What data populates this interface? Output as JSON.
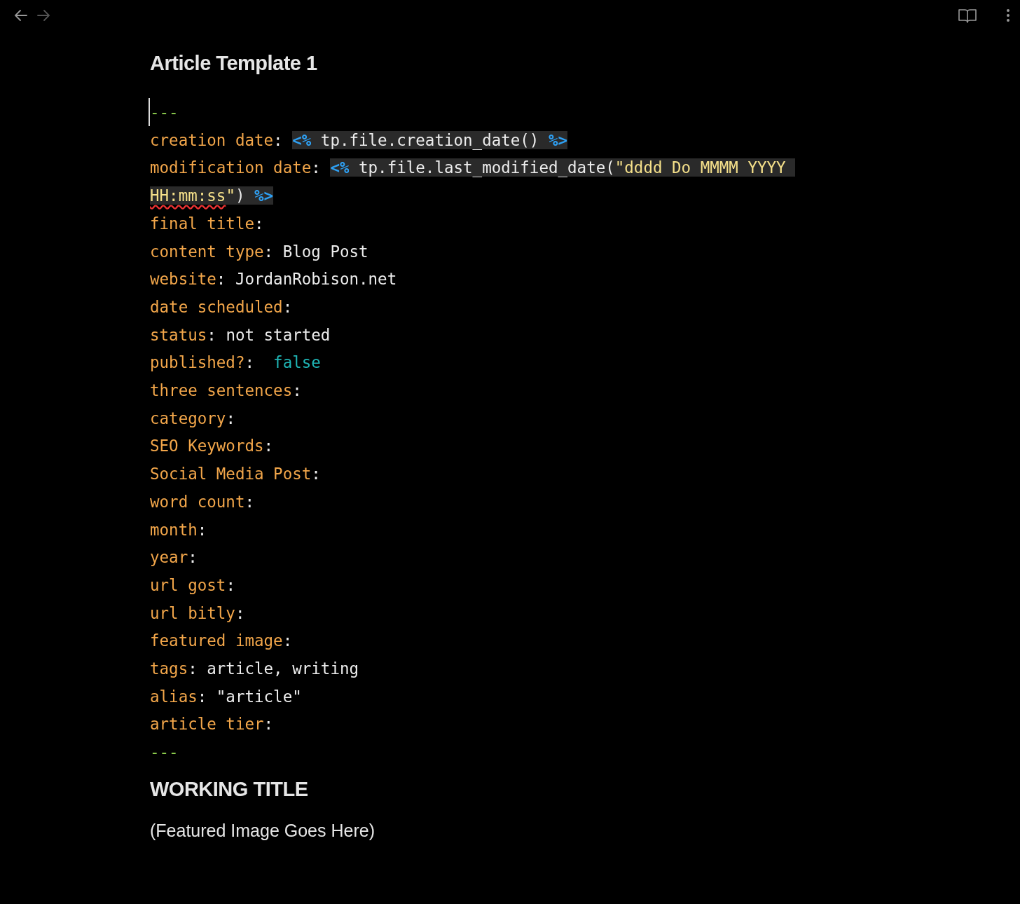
{
  "toolbar": {
    "back_disabled": false,
    "forward_disabled": true
  },
  "note": {
    "title": "Article Template 1",
    "frontmatter": [
      [
        {
          "kind": "dash",
          "text": "---"
        }
      ],
      [
        {
          "kind": "key",
          "text": "creation date"
        },
        {
          "kind": "punct",
          "text": ": "
        },
        {
          "kind": "delim",
          "text": "<%"
        },
        {
          "kind": "code",
          "text": " tp.file.creation_date() "
        },
        {
          "kind": "delim",
          "text": "%>"
        }
      ],
      [
        {
          "kind": "key",
          "text": "modification date"
        },
        {
          "kind": "punct",
          "text": ": "
        },
        {
          "kind": "delim",
          "text": "<%"
        },
        {
          "kind": "code",
          "text": " tp.file.last_modified_date("
        },
        {
          "kind": "string",
          "text": "\"dddd Do MMMM YYYY "
        },
        {
          "kind": "string",
          "text": "HH:mm:ss",
          "misspelled": true
        },
        {
          "kind": "string",
          "text": "\""
        },
        {
          "kind": "code",
          "text": ") "
        },
        {
          "kind": "delim",
          "text": "%>"
        }
      ],
      [
        {
          "kind": "key",
          "text": "final title"
        },
        {
          "kind": "punct",
          "text": ":"
        }
      ],
      [
        {
          "kind": "key",
          "text": "content type"
        },
        {
          "kind": "punct",
          "text": ": "
        },
        {
          "kind": "value",
          "text": "Blog Post"
        }
      ],
      [
        {
          "kind": "key",
          "text": "website"
        },
        {
          "kind": "punct",
          "text": ": "
        },
        {
          "kind": "value",
          "text": "JordanRobison.net"
        }
      ],
      [
        {
          "kind": "key",
          "text": "date scheduled"
        },
        {
          "kind": "punct",
          "text": ":"
        }
      ],
      [
        {
          "kind": "key",
          "text": "status"
        },
        {
          "kind": "punct",
          "text": ": "
        },
        {
          "kind": "value",
          "text": "not started"
        }
      ],
      [
        {
          "kind": "key",
          "text": "published?"
        },
        {
          "kind": "punct",
          "text": ":  "
        },
        {
          "kind": "bool",
          "text": "false"
        }
      ],
      [
        {
          "kind": "key",
          "text": "three sentences"
        },
        {
          "kind": "punct",
          "text": ":"
        }
      ],
      [
        {
          "kind": "key",
          "text": "category"
        },
        {
          "kind": "punct",
          "text": ":"
        }
      ],
      [
        {
          "kind": "key",
          "text": "SEO Keywords"
        },
        {
          "kind": "punct",
          "text": ":"
        }
      ],
      [
        {
          "kind": "key",
          "text": "Social Media Post"
        },
        {
          "kind": "punct",
          "text": ":"
        }
      ],
      [
        {
          "kind": "key",
          "text": "word count"
        },
        {
          "kind": "punct",
          "text": ":"
        }
      ],
      [
        {
          "kind": "key",
          "text": "month"
        },
        {
          "kind": "punct",
          "text": ":"
        }
      ],
      [
        {
          "kind": "key",
          "text": "year"
        },
        {
          "kind": "punct",
          "text": ":"
        }
      ],
      [
        {
          "kind": "key",
          "text": "url gost"
        },
        {
          "kind": "punct",
          "text": ":"
        }
      ],
      [
        {
          "kind": "key",
          "text": "url bitly"
        },
        {
          "kind": "punct",
          "text": ":"
        }
      ],
      [
        {
          "kind": "key",
          "text": "featured image"
        },
        {
          "kind": "punct",
          "text": ":"
        }
      ],
      [
        {
          "kind": "key",
          "text": "tags"
        },
        {
          "kind": "punct",
          "text": ": "
        },
        {
          "kind": "value",
          "text": "article, writing"
        }
      ],
      [
        {
          "kind": "key",
          "text": "alias"
        },
        {
          "kind": "punct",
          "text": ": "
        },
        {
          "kind": "value",
          "text": "\"article\""
        }
      ],
      [
        {
          "kind": "key",
          "text": "article tier"
        },
        {
          "kind": "punct",
          "text": ":"
        }
      ],
      [
        {
          "kind": "dash",
          "text": "---"
        }
      ]
    ],
    "heading": "WORKING TITLE",
    "paragraph": "(Featured Image Goes Here)"
  }
}
